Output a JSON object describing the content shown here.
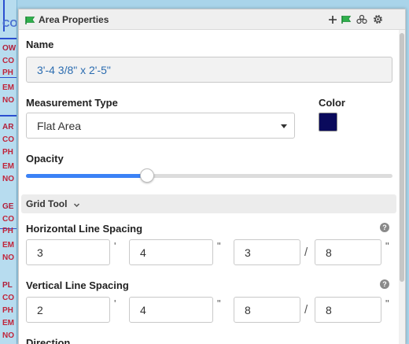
{
  "background": {
    "words": [
      "CO",
      "OW",
      "CO",
      "PH",
      "EM",
      "NO",
      "AR",
      "CO",
      "PH",
      "EM",
      "NO",
      "GE",
      "CO",
      "PH",
      "EM",
      "NO",
      "PL",
      "CO",
      "PH",
      "EM",
      "NO"
    ]
  },
  "window": {
    "title": "Area Properties",
    "icons": [
      "add-icon",
      "area-flag-icon",
      "group-icon",
      "gear-icon"
    ]
  },
  "form": {
    "name_label": "Name",
    "name_value": "3'-4 3/8\" x 2'-5\"",
    "measurement_label": "Measurement Type",
    "measurement_value": "Flat Area",
    "color_label": "Color",
    "color_value": "#0a0a5c",
    "opacity_label": "Opacity",
    "opacity_fraction": 0.33
  },
  "grid_tool": {
    "label": "Grid Tool",
    "horizontal": {
      "label": "Horizontal Line Spacing",
      "feet": "3",
      "inches": "4",
      "num": "3",
      "den": "8"
    },
    "vertical": {
      "label": "Vertical Line Spacing",
      "feet": "2",
      "inches": "4",
      "num": "8",
      "den": "8"
    },
    "direction_label": "Direction",
    "help": "?",
    "foot_mark": "'",
    "inch_mark": "\"",
    "slash": "/"
  }
}
